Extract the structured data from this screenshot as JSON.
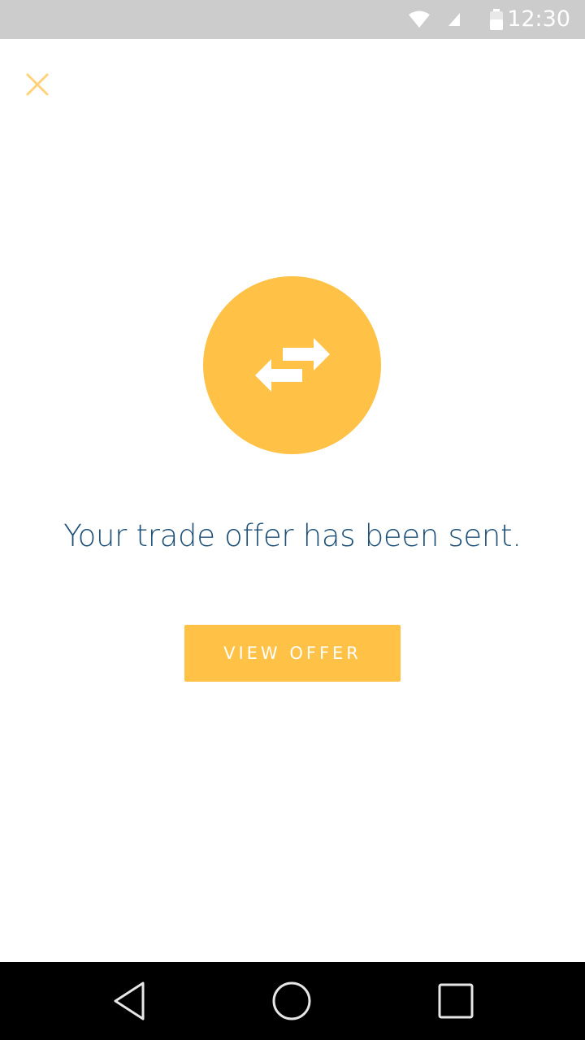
{
  "status_bar": {
    "time": "12:30",
    "icons": [
      "wifi-icon",
      "cell-signal-icon",
      "battery-icon"
    ]
  },
  "header": {
    "close_icon": "close-icon"
  },
  "main": {
    "icon": "swap-arrows-icon",
    "message": "Your trade offer has been sent.",
    "view_offer_label": "VIEW OFFER"
  },
  "nav_bar": {
    "icons": [
      "back-icon",
      "home-icon",
      "recents-icon"
    ]
  },
  "colors": {
    "accent": "#ffc246",
    "close_icon": "#ffd27a",
    "message_text": "#1d4f77",
    "status_bar": "#cccccc",
    "nav_bar": "#000000"
  }
}
